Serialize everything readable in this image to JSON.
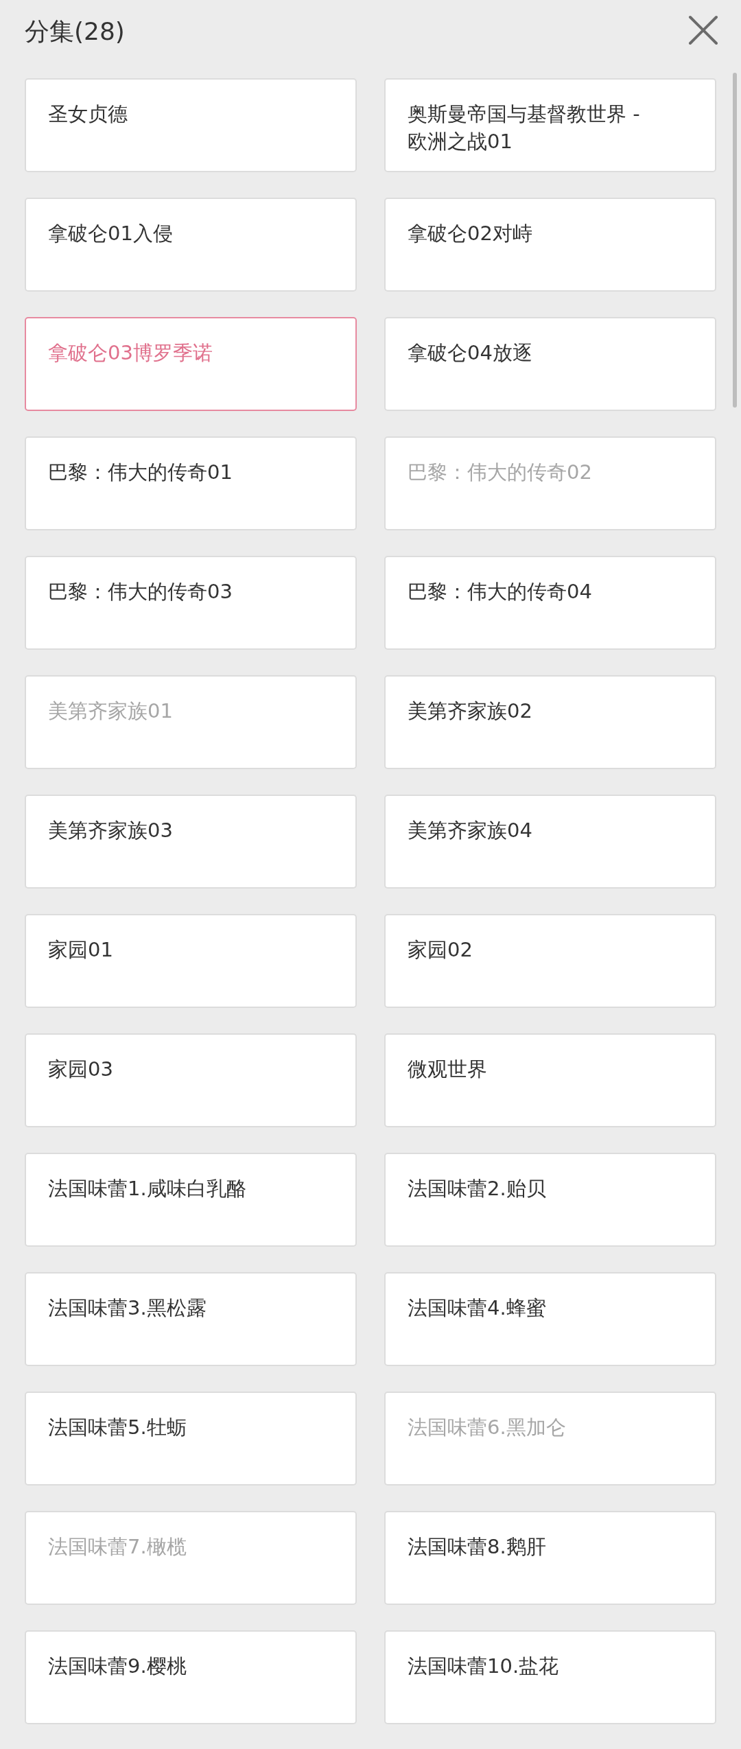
{
  "header": {
    "title": "分集(28)"
  },
  "episodes": [
    {
      "title": "圣女贞德",
      "selected": false,
      "disabled": false
    },
    {
      "title": "奥斯曼帝国与基督教世界 - 欧洲之战01",
      "selected": false,
      "disabled": false
    },
    {
      "title": "拿破仑01入侵",
      "selected": false,
      "disabled": false
    },
    {
      "title": "拿破仑02对峙",
      "selected": false,
      "disabled": false
    },
    {
      "title": "拿破仑03博罗季诺",
      "selected": true,
      "disabled": false
    },
    {
      "title": "拿破仑04放逐",
      "selected": false,
      "disabled": false
    },
    {
      "title": "巴黎：伟大的传奇01",
      "selected": false,
      "disabled": false
    },
    {
      "title": "巴黎：伟大的传奇02",
      "selected": false,
      "disabled": true
    },
    {
      "title": "巴黎：伟大的传奇03",
      "selected": false,
      "disabled": false
    },
    {
      "title": "巴黎：伟大的传奇04",
      "selected": false,
      "disabled": false
    },
    {
      "title": "美第齐家族01",
      "selected": false,
      "disabled": true
    },
    {
      "title": "美第齐家族02",
      "selected": false,
      "disabled": false
    },
    {
      "title": "美第齐家族03",
      "selected": false,
      "disabled": false
    },
    {
      "title": "美第齐家族04",
      "selected": false,
      "disabled": false
    },
    {
      "title": "家园01",
      "selected": false,
      "disabled": false
    },
    {
      "title": "家园02",
      "selected": false,
      "disabled": false
    },
    {
      "title": "家园03",
      "selected": false,
      "disabled": false
    },
    {
      "title": "微观世界",
      "selected": false,
      "disabled": false
    },
    {
      "title": "法国味蕾1.咸味白乳酪",
      "selected": false,
      "disabled": false
    },
    {
      "title": "法国味蕾2.贻贝",
      "selected": false,
      "disabled": false
    },
    {
      "title": "法国味蕾3.黑松露",
      "selected": false,
      "disabled": false
    },
    {
      "title": "法国味蕾4.蜂蜜",
      "selected": false,
      "disabled": false
    },
    {
      "title": "法国味蕾5.牡蛎",
      "selected": false,
      "disabled": false
    },
    {
      "title": "法国味蕾6.黑加仑",
      "selected": false,
      "disabled": true
    },
    {
      "title": "法国味蕾7.橄榄",
      "selected": false,
      "disabled": true
    },
    {
      "title": "法国味蕾8.鹅肝",
      "selected": false,
      "disabled": false
    },
    {
      "title": "法国味蕾9.樱桃",
      "selected": false,
      "disabled": false
    },
    {
      "title": "法国味蕾10.盐花",
      "selected": false,
      "disabled": false
    }
  ]
}
